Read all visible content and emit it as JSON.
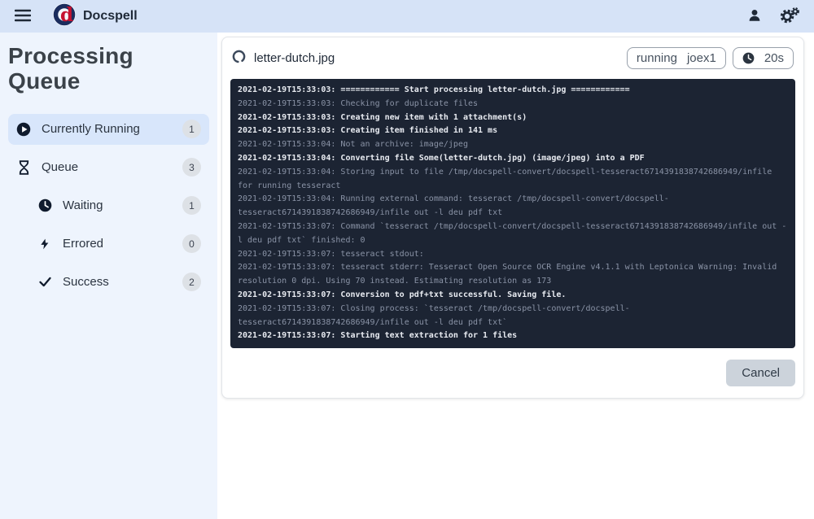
{
  "navbar": {
    "brand": "Docspell"
  },
  "sidebar": {
    "title": "Processing Queue",
    "items": [
      {
        "label": "Currently Running",
        "count": "1",
        "icon": "play-circle",
        "active": true,
        "indent": false
      },
      {
        "label": "Queue",
        "count": "3",
        "icon": "hourglass",
        "active": false,
        "indent": false
      },
      {
        "label": "Waiting",
        "count": "1",
        "icon": "clock",
        "active": false,
        "indent": true
      },
      {
        "label": "Errored",
        "count": "0",
        "icon": "bolt",
        "active": false,
        "indent": true
      },
      {
        "label": "Success",
        "count": "2",
        "icon": "check",
        "active": false,
        "indent": true
      }
    ]
  },
  "job": {
    "filename": "letter-dutch.jpg",
    "state_badge": "running",
    "worker_badge": "joex1",
    "runtime": "20s",
    "cancel_label": "Cancel",
    "log": [
      {
        "em": true,
        "text": "2021-02-19T15:33:03: ============ Start processing letter-dutch.jpg ============"
      },
      {
        "em": false,
        "text": "2021-02-19T15:33:03: Checking for duplicate files"
      },
      {
        "em": true,
        "text": "2021-02-19T15:33:03: Creating new item with 1 attachment(s)"
      },
      {
        "em": true,
        "text": "2021-02-19T15:33:03: Creating item finished in 141 ms"
      },
      {
        "em": false,
        "text": "2021-02-19T15:33:04: Not an archive: image/jpeg"
      },
      {
        "em": true,
        "text": "2021-02-19T15:33:04: Converting file Some(letter-dutch.jpg) (image/jpeg) into a PDF"
      },
      {
        "em": false,
        "text": "2021-02-19T15:33:04: Storing input to file /tmp/docspell-convert/docspell-tesseract6714391838742686949/infile for running tesseract"
      },
      {
        "em": false,
        "text": "2021-02-19T15:33:04: Running external command: tesseract /tmp/docspell-convert/docspell-tesseract6714391838742686949/infile out -l deu pdf txt"
      },
      {
        "em": false,
        "text": "2021-02-19T15:33:07: Command `tesseract /tmp/docspell-convert/docspell-tesseract6714391838742686949/infile out -l deu pdf txt` finished: 0"
      },
      {
        "em": false,
        "text": "2021-02-19T15:33:07: tesseract stdout:"
      },
      {
        "em": false,
        "text": "2021-02-19T15:33:07: tesseract stderr: Tesseract Open Source OCR Engine v4.1.1 with Leptonica Warning: Invalid resolution 0 dpi. Using 70 instead. Estimating resolution as 173"
      },
      {
        "em": true,
        "text": "2021-02-19T15:33:07: Conversion to pdf+txt successful. Saving file."
      },
      {
        "em": false,
        "text": "2021-02-19T15:33:07: Closing process: `tesseract /tmp/docspell-convert/docspell-tesseract6714391838742686949/infile out -l deu pdf txt`"
      },
      {
        "em": true,
        "text": "2021-02-19T15:33:07: Starting text extraction for 1 files"
      }
    ]
  },
  "colors": {
    "navbar_bg": "#d6e3f7",
    "sidebar_bg": "#eef4fd",
    "active_item_bg": "#d8e6fb",
    "badge_bg": "#dde1e6",
    "log_bg": "#1c2433",
    "log_text_dim": "#8a93a6",
    "log_text_bright": "#e8ebf1",
    "brand_navy": "#1b2d5e",
    "brand_red": "#c51230",
    "cancel_bg": "#ccd3db"
  }
}
